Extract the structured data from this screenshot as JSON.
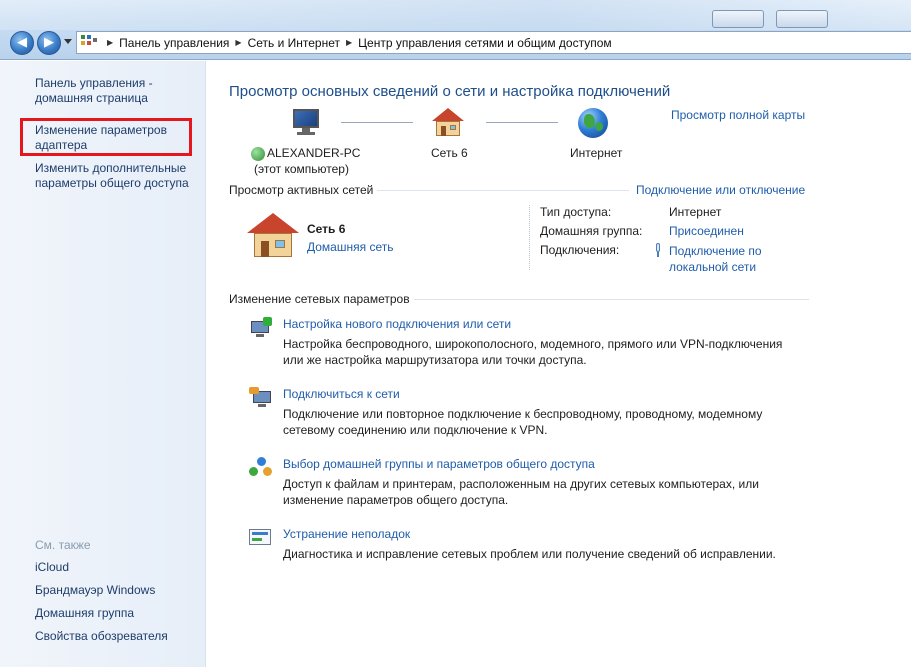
{
  "address_bar": {
    "crumbs": [
      "Панель управления",
      "Сеть и Интернет",
      "Центр управления сетями и общим доступом"
    ]
  },
  "left_pane": {
    "home_link": [
      "Панель управления -",
      "домашняя страница"
    ],
    "adapter_link": [
      "Изменение параметров",
      "адаптера"
    ],
    "sharing_link": [
      "Изменить дополнительные",
      "параметры общего доступа"
    ],
    "see_also_label": "См. также",
    "see_also": [
      "iCloud",
      "Брандмауэр Windows",
      "Домашняя группа",
      "Свойства обозревателя"
    ]
  },
  "main": {
    "title": "Просмотр основных сведений о сети и настройка подключений",
    "full_map_link": "Просмотр полной карты",
    "map": {
      "computer_name": "ALEXANDER-PC",
      "computer_sub": "(этот компьютер)",
      "network_name": "Сеть  6",
      "internet_label": "Интернет"
    },
    "active_networks_label": "Просмотр активных сетей",
    "connect_disconnect_link": "Подключение или отключение",
    "active_network": {
      "name": "Сеть  6",
      "type_link": "Домашняя сеть",
      "access_type_label": "Тип доступа:",
      "access_type_value": "Интернет",
      "homegroup_label": "Домашняя группа:",
      "homegroup_value": "Присоединен",
      "connections_label": "Подключения:",
      "connections_value": [
        "Подключение по",
        "локальной сети"
      ]
    },
    "change_settings_label": "Изменение сетевых параметров",
    "tasks": [
      {
        "title": "Настройка нового подключения или сети",
        "desc": [
          "Настройка беспроводного, широкополосного, модемного, прямого или VPN-подключения",
          "или же настройка маршрутизатора или точки доступа."
        ],
        "icon": "new-connection-icon"
      },
      {
        "title": "Подключиться к сети",
        "desc": [
          "Подключение или повторное подключение к беспроводному, проводному, модемному",
          "сетевому соединению или подключение к VPN."
        ],
        "icon": "connect-network-icon"
      },
      {
        "title": "Выбор домашней группы и параметров общего доступа",
        "desc": [
          "Доступ к файлам и принтерам, расположенным на других сетевых компьютерах, или",
          "изменение параметров общего доступа."
        ],
        "icon": "homegroup-icon"
      },
      {
        "title": "Устранение неполадок",
        "desc": [
          "Диагностика и исправление сетевых проблем или получение сведений об исправлении."
        ],
        "icon": "troubleshoot-icon"
      }
    ]
  },
  "colors": {
    "link": "#1f5dab",
    "heading": "#1e4e8c",
    "highlight": "#e5161c"
  }
}
